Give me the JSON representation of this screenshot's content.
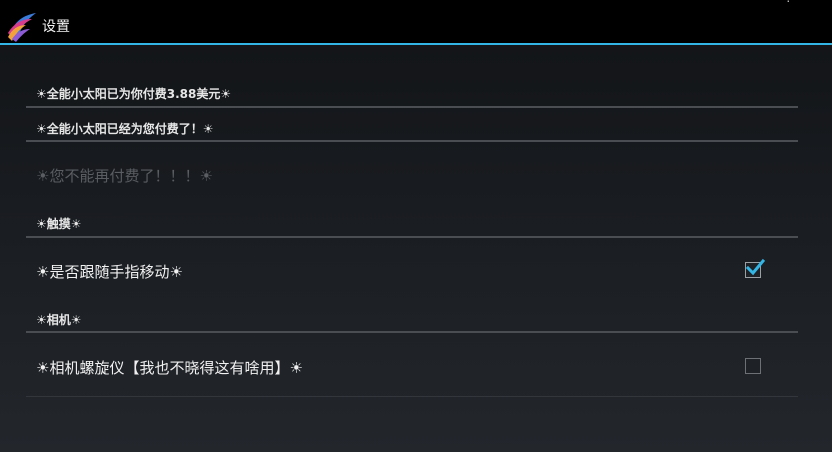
{
  "status_bar": {
    "text": "--:--"
  },
  "action_bar": {
    "title": "设置",
    "app_icon": "app-logo-icon"
  },
  "preferences": {
    "header_1": "☀全能小太阳已为你付费3.88美元☀",
    "header_2": "☀全能小太阳已经为您付费了！☀",
    "pay_again": "☀您不能再付费了！！！☀",
    "category_touch": "☀触摸☀",
    "follow_finger": {
      "label": "☀是否跟随手指移动☀",
      "checked": true
    },
    "category_camera": "☀相机☀",
    "camera_gyroscope": {
      "label": "☀相机螺旋仪【我也不晓得这有啥用】☀",
      "checked": false
    }
  },
  "colors": {
    "accent": "#33b5e5",
    "background": "#181b1f",
    "action_bar": "#000000",
    "text": "#f0f0f0",
    "disabled_text": "#5a5d62"
  }
}
